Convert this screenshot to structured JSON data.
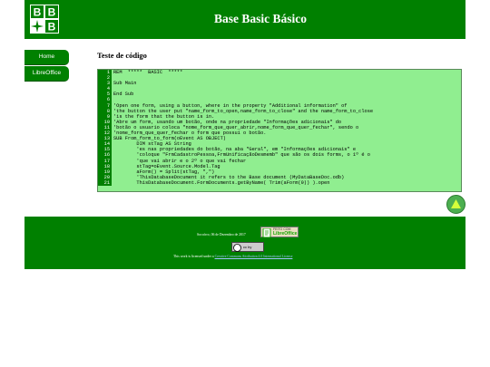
{
  "header": {
    "title": "Base Basic Básico",
    "logo_letters": [
      "B",
      "B",
      "B"
    ]
  },
  "nav": {
    "items": [
      {
        "label": "Home"
      },
      {
        "label": "LibreOffice"
      }
    ]
  },
  "content": {
    "heading": "Teste de código",
    "code_lines": [
      "REM  *****  BASIC  *****",
      "",
      "Sub Main",
      "",
      "End Sub",
      "",
      "'Open one form, using a button, where in the property \"Additional information\" of",
      "'the button the user put \"name_form_to_open,name_form_to_close\" and the name_form_to_close",
      "'is the form that the button is in.",
      "'Abre um form, usando um botão, onde na propriedade \"Informações adicionais\" do",
      "'botão o usuario coloca \"nome_form_que_quer_abrir,nome_form_que_quer_fechar\", sendo o",
      "'nome_form_que_quer_fechar o form que possui o botão.",
      "SUB From_form_to_form(oEvent AS OBJECT)",
      "        DIM stTag AS String",
      "        'es nas propriedades do botão, na aba \"Geral\", em \"Informações adicionais\" e",
      "        'coloque \"FrmCadastroPessoa,FrmUnificaçãoDesmemb\" que são os dois forms, o 1º é o",
      "        'que vai abrir e o 2º o que vai fechar",
      "        stTag=oEvent.Source.Model.Tag",
      "        aForm() = Split(stTag, \",\")",
      "        'ThisDatabaseDocument it refers to the Base document (MyDataBaseDoc.odb)",
      "        ThisDatabaseDocument.FormDocuments.getByName( Trim(aForm(0)) ).open"
    ]
  },
  "footer": {
    "date": "Soccórro, 06 de Dezembro de 2017",
    "badge_top": "FEITO COM",
    "badge_bottom": "LibreOffice",
    "cc_label": "cc by",
    "license_prefix": "This work is licensed under a",
    "license_link": "Creative Commons Attribution 4.0 International License"
  },
  "colors": {
    "header_bg": "#008000",
    "code_bg": "#90ee90",
    "line_number_bg": "#008000"
  }
}
